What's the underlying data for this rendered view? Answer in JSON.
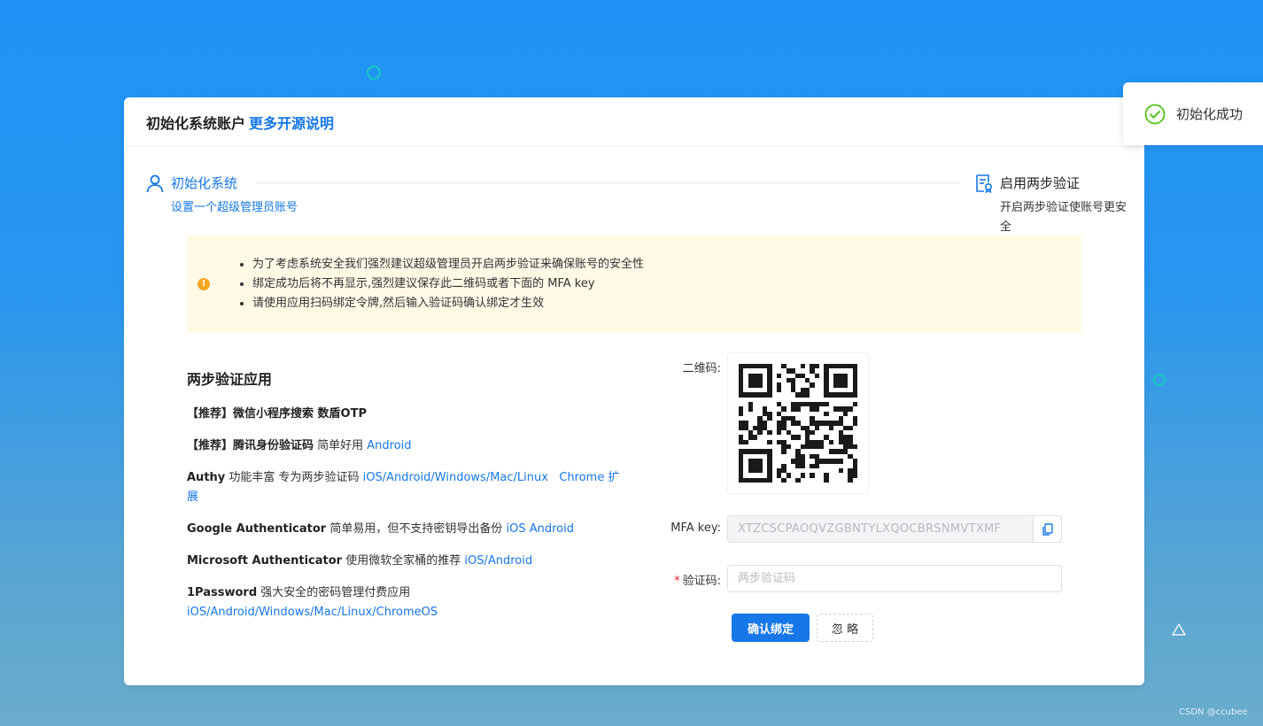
{
  "header": {
    "title": "初始化系统账户",
    "link": "更多开源说明"
  },
  "steps": [
    {
      "title": "初始化系统",
      "desc": "设置一个超级管理员账号",
      "icon": "user-icon",
      "status": "active"
    },
    {
      "title": "启用两步验证",
      "desc": "开启两步验证使账号更安全",
      "icon": "document-check-icon",
      "status": "pending"
    }
  ],
  "alert": {
    "icon": "warning-icon",
    "items": [
      "为了考虑系统安全我们强烈建议超级管理员开启两步验证来确保账号的安全性",
      "绑定成功后将不再显示,强烈建议保存此二维码或者下面的 MFA key",
      "请使用应用扫码绑定令牌,然后输入验证码确认绑定才生效"
    ]
  },
  "apps": {
    "title": "两步验证应用",
    "items": [
      {
        "name": "【推荐】微信小程序搜索 数盾OTP",
        "desc": "",
        "links": ""
      },
      {
        "name": "【推荐】腾讯身份验证码",
        "desc": " 简单好用 ",
        "links": "Android"
      },
      {
        "name": "Authy",
        "desc": " 功能丰富 专为两步验证码 ",
        "links": "iOS/Android/Windows/Mac/Linux   Chrome 扩展"
      },
      {
        "name": "Google Authenticator",
        "desc": " 简单易用，但不支持密钥导出备份 ",
        "links": "iOS Android"
      },
      {
        "name": "Microsoft Authenticator",
        "desc": " 使用微软全家桶的推荐 ",
        "links": "iOS/Android"
      },
      {
        "name": "1Password",
        "desc": " 强大安全的密码管理付费应用 ",
        "links": "iOS/Android/Windows/Mac/Linux/ChromeOS"
      }
    ]
  },
  "form": {
    "qr_label": "二维码:",
    "mfa_label": "MFA key:",
    "mfa_value": "XTZCSCPAOQVZGBNTYLXQOCBRSNMVTXMF",
    "code_required_mark": "*",
    "code_label": "验证码:",
    "code_placeholder": "两步验证码",
    "confirm_label": "确认绑定",
    "skip_label": "忽 略"
  },
  "toast": {
    "text": "初始化成功",
    "icon": "check-circle-icon"
  },
  "watermark": "CSDN @ccubee",
  "colors": {
    "accent": "#1677e8",
    "warning": "#f5a623",
    "alert_bg": "#fff9e6",
    "success": "#52c41a"
  }
}
